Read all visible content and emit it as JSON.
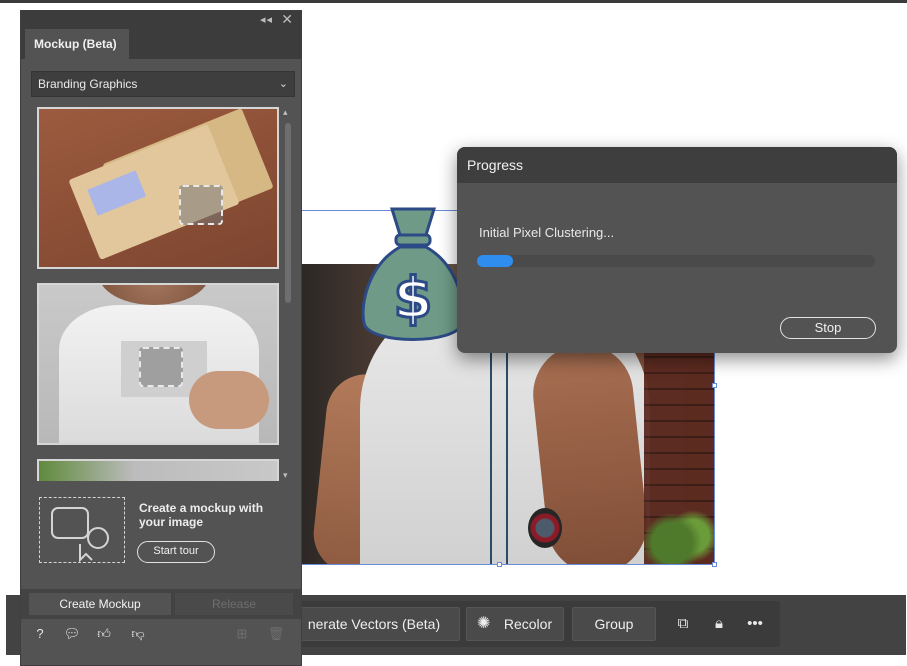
{
  "panel": {
    "tab_label": "Mockup (Beta)",
    "category_selected": "Branding Graphics",
    "tour_text": "Create a mockup with your image",
    "start_tour_label": "Start tour",
    "create_mockup_label": "Create Mockup",
    "release_label": "Release"
  },
  "progress_dialog": {
    "title": "Progress",
    "status_text": "Initial Pixel Clustering...",
    "progress_fraction": 0.09,
    "stop_label": "Stop"
  },
  "taskbar": {
    "generate_vectors_label": "nerate Vectors (Beta)",
    "recolor_label": "Recolor",
    "group_label": "Group"
  },
  "colors": {
    "accent": "#2f8df0",
    "panel_bg": "#535353",
    "selection": "#6a8cd8",
    "moneybag_fill": "#6f9a87",
    "moneybag_stroke": "#2c4a86"
  },
  "icons": {
    "help": "help-icon",
    "feedback": "feedback-icon",
    "thumbs_up": "thumbs-up-icon",
    "thumbs_down": "thumbs-down-icon",
    "add": "add-icon",
    "delete": "trash-icon",
    "recolor": "recolor-icon",
    "arrange": "arrange-icon",
    "lock": "lock-icon",
    "more": "more-icon"
  }
}
